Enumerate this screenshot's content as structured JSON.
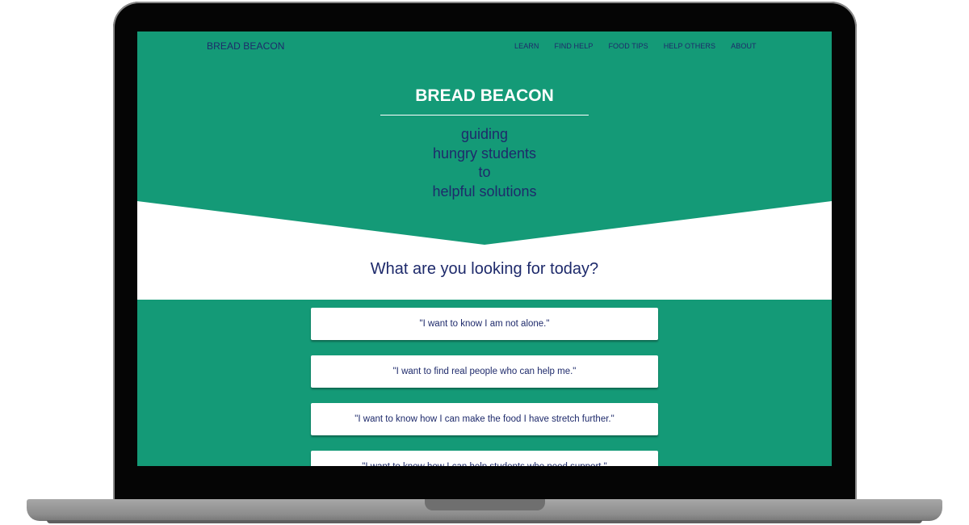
{
  "site": {
    "brand": "BREAD BEACON",
    "nav": [
      "LEARN",
      "FIND HELP",
      "FOOD TIPS",
      "HELP OTHERS",
      "ABOUT"
    ]
  },
  "hero": {
    "title": "BREAD BEACON",
    "tagline": [
      "guiding",
      "hungry students",
      "to",
      "helpful solutions"
    ]
  },
  "prompt": {
    "question": "What are you looking for today?"
  },
  "options": [
    "\"I want to know I am not alone.\"",
    "\"I want to find real people who can help me.\"",
    "\"I want to know how I can make the food I have stretch further.\"",
    "\"I want to know how I can help students who need support.\""
  ],
  "colors": {
    "primary_green": "#149a77",
    "navy_text": "#1e2a6b",
    "white": "#ffffff",
    "bezel": "#050505",
    "laptop_base": "#9a9a9a"
  }
}
